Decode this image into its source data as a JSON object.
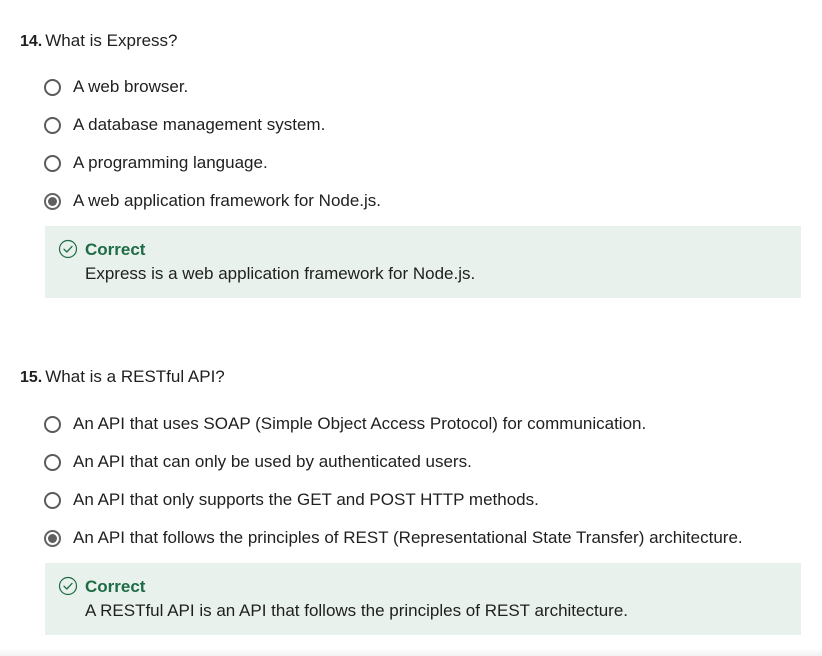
{
  "questions": [
    {
      "number": "14.",
      "text": "What is Express?",
      "options": [
        {
          "label": "A web browser.",
          "selected": false
        },
        {
          "label": "A database management system.",
          "selected": false
        },
        {
          "label": "A programming language.",
          "selected": false
        },
        {
          "label": "A web application framework for Node.js.",
          "selected": true
        }
      ],
      "feedback": {
        "status": "Correct",
        "explanation": "Express is a web application framework for Node.js."
      }
    },
    {
      "number": "15.",
      "text": "What is a RESTful API?",
      "options": [
        {
          "label": "An API that uses SOAP (Simple Object Access Protocol) for communication.",
          "selected": false
        },
        {
          "label": "An API that can only be used by authenticated users.",
          "selected": false
        },
        {
          "label": "An API that only supports the GET and POST HTTP methods.",
          "selected": false
        },
        {
          "label": "An API that follows the principles of REST (Representational State Transfer) architecture.",
          "selected": true
        }
      ],
      "feedback": {
        "status": "Correct",
        "explanation": "A RESTful API is an API that follows the principles of REST architecture."
      }
    }
  ],
  "colors": {
    "correct_text": "#1e6b45",
    "feedback_bg": "#e8f1ec",
    "radio_border": "#5b5b5b"
  },
  "icons": {
    "feedback": "check-circle-icon"
  }
}
